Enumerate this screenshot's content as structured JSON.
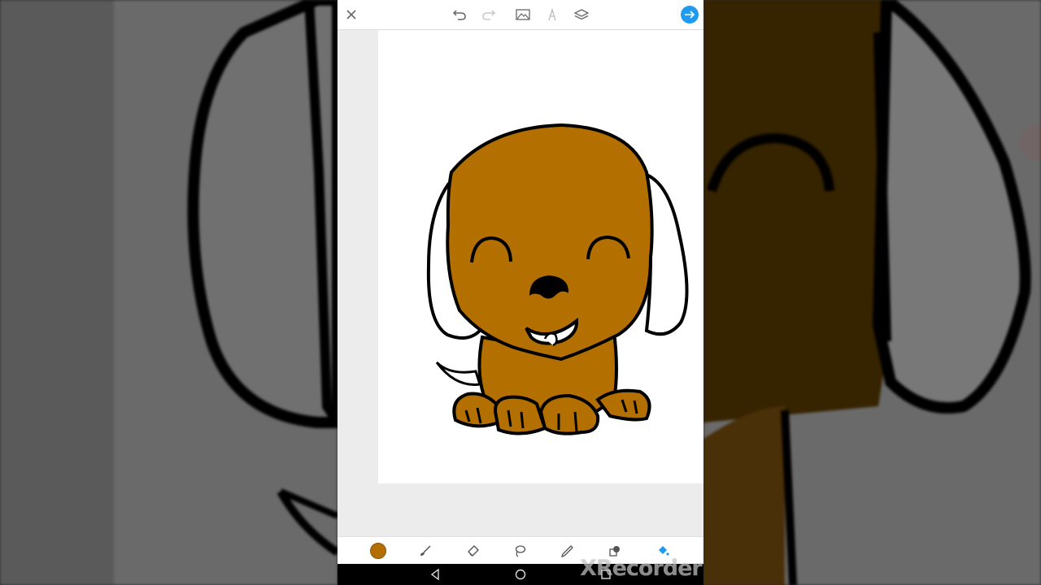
{
  "app": {
    "watermark": "XRecorder"
  },
  "topbar": {
    "icons": [
      "close-icon",
      "undo-icon",
      "redo-icon",
      "image-icon",
      "text-icon",
      "layers-icon",
      "next-arrow-icon"
    ]
  },
  "toolbar": {
    "current_color": "#b36f00",
    "tools": [
      "color-picker",
      "brush-icon",
      "eraser-icon",
      "lasso-icon",
      "pen-icon",
      "shape-icon",
      "fill-bucket-icon"
    ],
    "active_tool": "fill-bucket-icon",
    "accent_color": "#1e9bf0"
  },
  "canvas": {
    "drawing_subject": "dog",
    "fill_color": "#b36f00"
  },
  "navbar": {
    "icons": [
      "back-icon",
      "home-icon",
      "recents-icon"
    ]
  }
}
